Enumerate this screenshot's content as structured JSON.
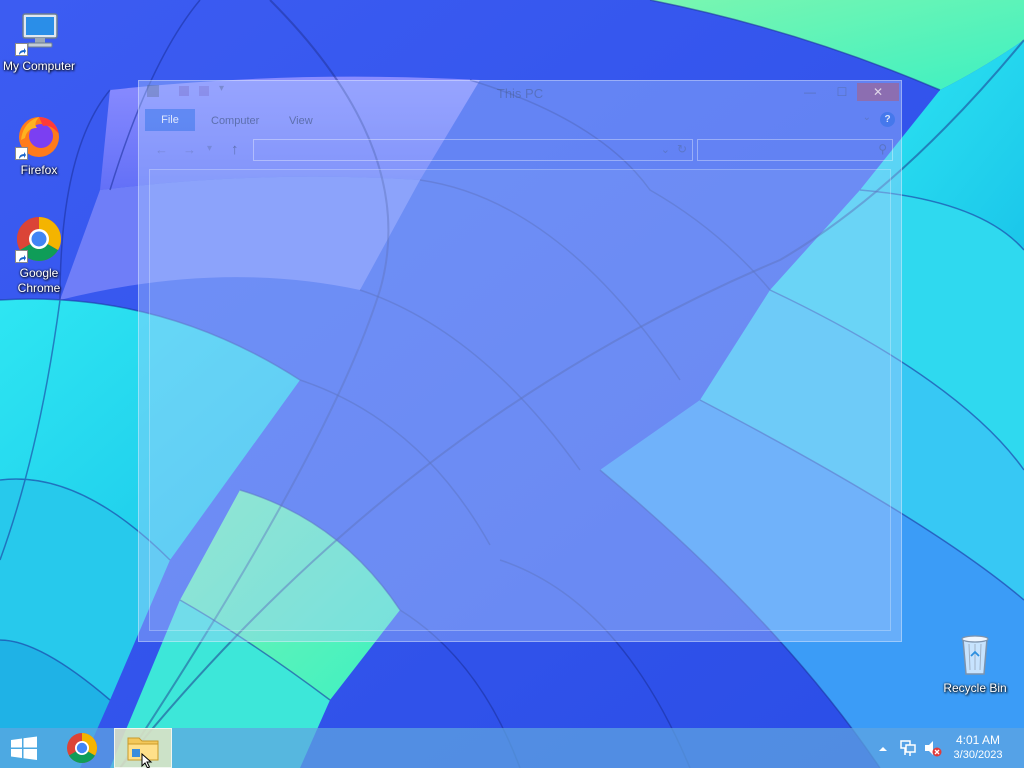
{
  "desktop": {
    "icons": [
      {
        "label": "My Computer",
        "icon": "computer-icon"
      },
      {
        "label": "Firefox",
        "icon": "firefox-icon"
      },
      {
        "label": "Google\nChrome",
        "icon": "chrome-icon"
      },
      {
        "label": "Recycle Bin",
        "icon": "recycle-bin-icon"
      }
    ]
  },
  "window": {
    "title": "This PC",
    "state": "closing-animation",
    "ribbon_tabs": [
      "File",
      "Computer",
      "View"
    ],
    "close_glyph": "✕",
    "minimize_glyph": "—",
    "maximize_glyph": "☐",
    "help_glyph": "?",
    "up_glyph": "↑"
  },
  "taskbar": {
    "start_icon": "windows-logo-icon",
    "pinned": [
      {
        "name": "Google Chrome",
        "icon": "chrome-icon"
      },
      {
        "name": "File Explorer",
        "icon": "folder-icon",
        "active": true
      }
    ],
    "tray": {
      "overflow_icon": "chevron-up-icon",
      "network_icon": "network-icon",
      "volume_icon": "volume-muted-icon"
    },
    "clock": {
      "time": "4:01 AM",
      "date": "3/30/2023"
    }
  },
  "colors": {
    "taskbar": "#5fa5e1",
    "wallpaper_primary": "#2f6bf0",
    "wallpaper_cyan": "#1fd8ee",
    "wallpaper_green": "#58f2b0",
    "explorer_highlight": "#fff4be"
  }
}
